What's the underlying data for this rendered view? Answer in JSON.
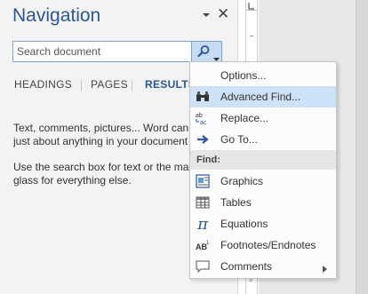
{
  "pane": {
    "title": "Navigation",
    "close_glyph": "✕"
  },
  "search": {
    "placeholder": "Search document"
  },
  "tabs": [
    {
      "label": "HEADINGS",
      "active": false
    },
    {
      "label": "PAGES",
      "active": false
    },
    {
      "label": "RESULTS",
      "active": true
    }
  ],
  "results": {
    "line1": "Text, comments, pictures... Word can f",
    "line2": "just about anything in your document",
    "line3": "Use the search box for text or the mag",
    "line4": "glass for everything else."
  },
  "ruler": {
    "numbers": [
      "4",
      "5"
    ]
  },
  "menu": {
    "items": [
      {
        "label": "Options...",
        "icon": "none"
      },
      {
        "label": "Advanced Find...",
        "icon": "binoculars-icon",
        "hovered": true
      },
      {
        "label": "Replace...",
        "icon": "replace-icon"
      },
      {
        "label": "Go To...",
        "icon": "arrow-right-icon"
      }
    ],
    "find_header": "Find:",
    "find_items": [
      {
        "label": "Graphics",
        "icon": "graphics-icon"
      },
      {
        "label": "Tables",
        "icon": "table-icon"
      },
      {
        "label": "Equations",
        "icon": "pi-icon"
      },
      {
        "label": "Footnotes/Endnotes",
        "icon": "footnote-icon"
      },
      {
        "label": "Comments",
        "icon": "comment-icon",
        "submenu": true
      }
    ]
  },
  "colors": {
    "accent": "#2b579a",
    "hover": "#cde2f6",
    "search_button": "#c5dcf2"
  }
}
